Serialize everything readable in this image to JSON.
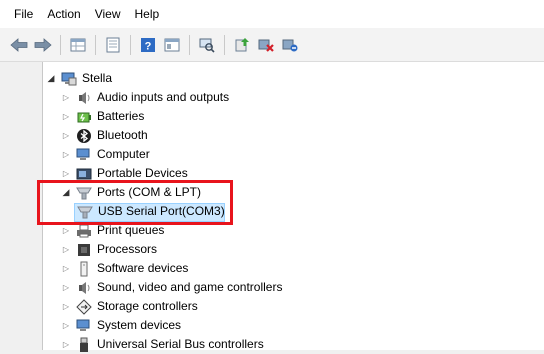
{
  "menu": [
    "File",
    "Action",
    "View",
    "Help"
  ],
  "toolbar": {
    "icons": [
      "back-icon",
      "forward-icon",
      "properties-grid-icon",
      "console-tree-icon",
      "help-icon",
      "view-pane-icon",
      "scan-hardware-icon",
      "update-driver-icon",
      "uninstall-device-icon",
      "disable-device-icon"
    ]
  },
  "tree": {
    "root": "Stella",
    "items": [
      {
        "label": "Audio inputs and outputs",
        "icon": "speaker-icon"
      },
      {
        "label": "Batteries",
        "icon": "battery-icon"
      },
      {
        "label": "Bluetooth",
        "icon": "bluetooth-icon"
      },
      {
        "label": "Computer",
        "icon": "computer-icon"
      },
      {
        "label": "Portable Devices",
        "icon": "portable-device-icon"
      },
      {
        "label": "Ports (COM & LPT)",
        "icon": "port-icon"
      },
      {
        "label": "Print queues",
        "icon": "printer-icon"
      },
      {
        "label": "Processors",
        "icon": "processor-icon"
      },
      {
        "label": "Software devices",
        "icon": "software-device-icon"
      },
      {
        "label": "Sound, video and game controllers",
        "icon": "speaker-icon"
      },
      {
        "label": "Storage controllers",
        "icon": "storage-icon"
      },
      {
        "label": "System devices",
        "icon": "computer-icon"
      },
      {
        "label": "Universal Serial Bus controllers",
        "icon": "usb-icon"
      }
    ],
    "child": {
      "label": "USB Serial Port(COM3)",
      "icon": "port-icon"
    }
  },
  "colors": {
    "highlight": "#e8141c",
    "selection": "#cce8ff"
  }
}
